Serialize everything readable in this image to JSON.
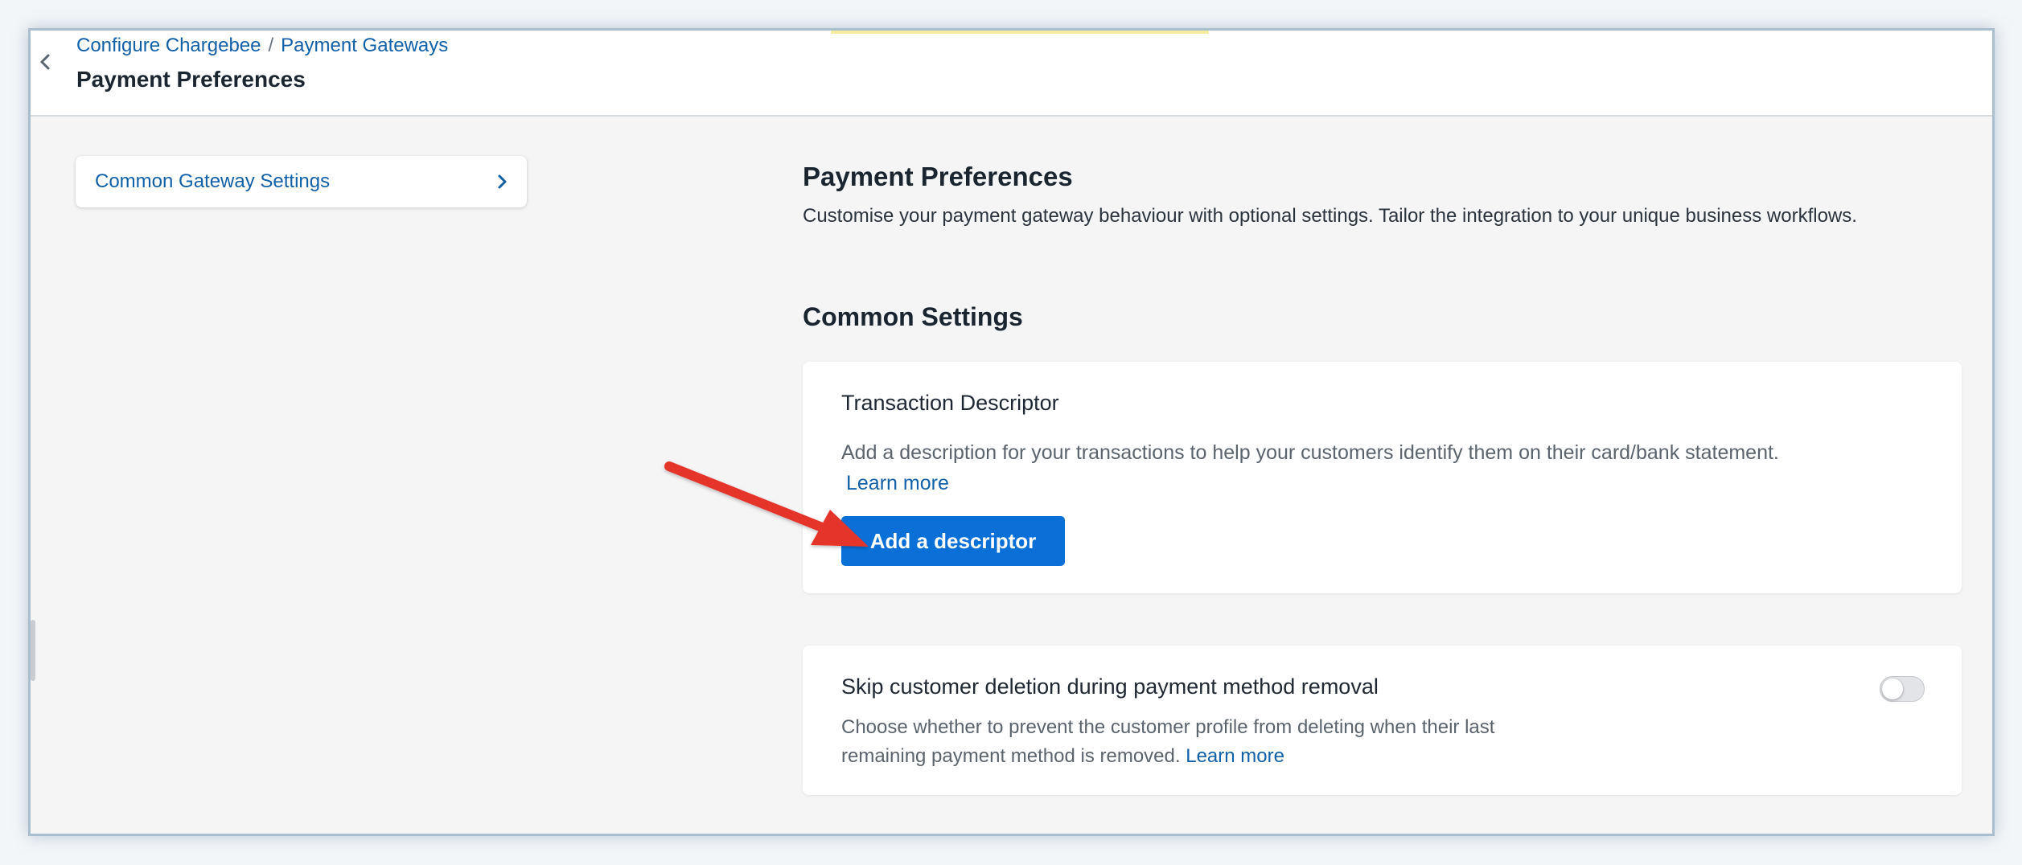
{
  "breadcrumb": {
    "items": [
      "Configure Chargebee",
      "Payment Gateways"
    ],
    "separator": "/"
  },
  "header": {
    "title": "Payment Preferences"
  },
  "sidebar": {
    "items": [
      {
        "label": "Common Gateway Settings"
      }
    ]
  },
  "main": {
    "title": "Payment Preferences",
    "intro": "Customise your payment gateway behaviour with optional settings. Tailor the integration to your unique business workflows.",
    "section_title": "Common Settings",
    "descriptor_card": {
      "title": "Transaction Descriptor",
      "description": "Add a description for your transactions to help your customers identify them on their card/bank statement.",
      "learn_more": "Learn more",
      "button_label": "Add a descriptor"
    },
    "skip_card": {
      "title": "Skip customer deletion during payment method removal",
      "description": "Choose whether to prevent the customer profile from deleting when their last remaining payment method is removed.",
      "learn_more": "Learn more",
      "toggle_on": false
    }
  },
  "colors": {
    "link": "#1260a8",
    "primary_button": "#0a70d8",
    "annotation_arrow": "#e5342a"
  },
  "icons": {
    "back": "chevron-left-icon",
    "nav_item": "chevron-right-icon"
  }
}
